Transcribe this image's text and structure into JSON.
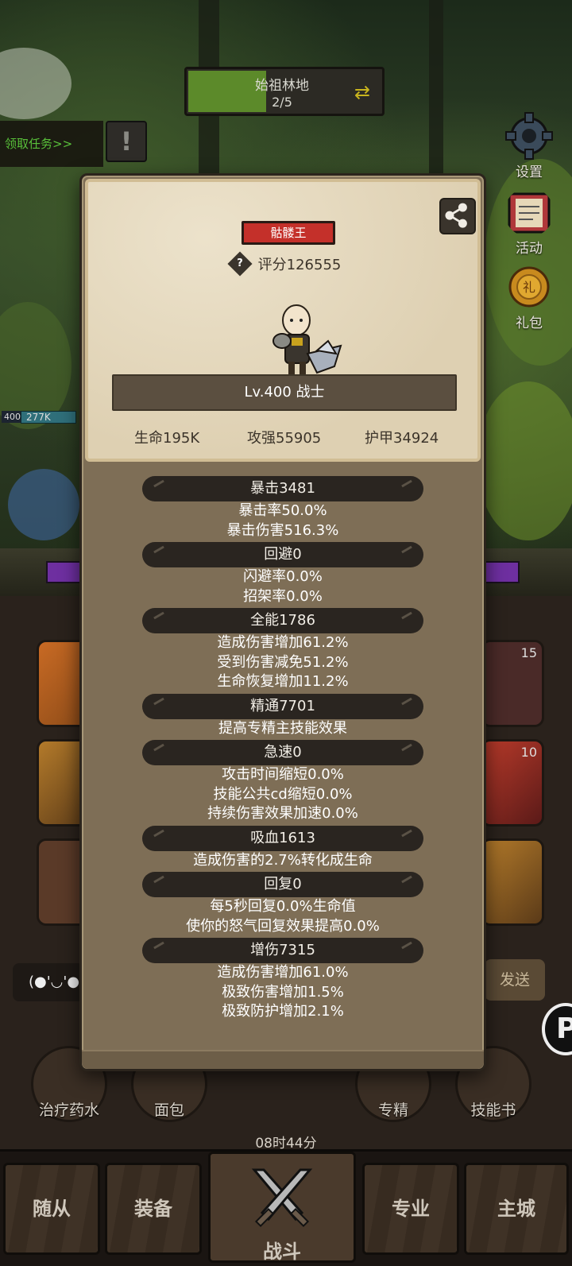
{
  "stage": {
    "name": "始祖林地",
    "progress": "2/5",
    "progress_fraction": 0.4
  },
  "quest": {
    "label": "领取任务>>",
    "alert": "!"
  },
  "side_menu": [
    {
      "label": "设置",
      "icon": "gear-icon"
    },
    {
      "label": "活动",
      "icon": "scroll-icon"
    },
    {
      "label": "礼包",
      "icon": "gift-coin-icon"
    }
  ],
  "hp_label": {
    "level": "400",
    "value": "277K"
  },
  "slot_counts": {
    "slot_a": "15",
    "slot_b": "10"
  },
  "chat": {
    "emote": "(●'◡'●",
    "send": "发送"
  },
  "quick_items": [
    "治疗药水",
    "面包",
    "专精",
    "技能书"
  ],
  "timer": "08时44分",
  "nav": {
    "tabs": [
      "随从",
      "装备",
      "战斗",
      "专业",
      "主城"
    ],
    "active": "战斗"
  },
  "popup": {
    "title": "骷髅王",
    "score": "评分126555",
    "level_class": "Lv.400 战士",
    "base_stats": {
      "hp": "生命195K",
      "atk": "攻强55905",
      "armor": "护甲34924"
    },
    "sections": [
      {
        "header": "暴击3481",
        "lines": [
          "暴击率50.0%",
          "暴击伤害516.3%"
        ]
      },
      {
        "header": "回避0",
        "lines": [
          "闪避率0.0%",
          "招架率0.0%"
        ]
      },
      {
        "header": "全能1786",
        "lines": [
          "造成伤害增加61.2%",
          "受到伤害减免51.2%",
          "生命恢复增加11.2%"
        ]
      },
      {
        "header": "精通7701",
        "lines": [
          "提高专精主技能效果"
        ]
      },
      {
        "header": "急速0",
        "lines": [
          "攻击时间缩短0.0%",
          "技能公共cd缩短0.0%",
          "持续伤害效果加速0.0%"
        ]
      },
      {
        "header": "吸血1613",
        "lines": [
          "造成伤害的2.7%转化成生命"
        ]
      },
      {
        "header": "回复0",
        "lines": [
          "每5秒回复0.0%生命值",
          "使你的怒气回复效果提高0.0%"
        ]
      },
      {
        "header": "增伤7315",
        "lines": [
          "造成伤害增加61.0%",
          "极致伤害增加1.5%",
          "极致防护增加2.1%"
        ]
      }
    ]
  }
}
